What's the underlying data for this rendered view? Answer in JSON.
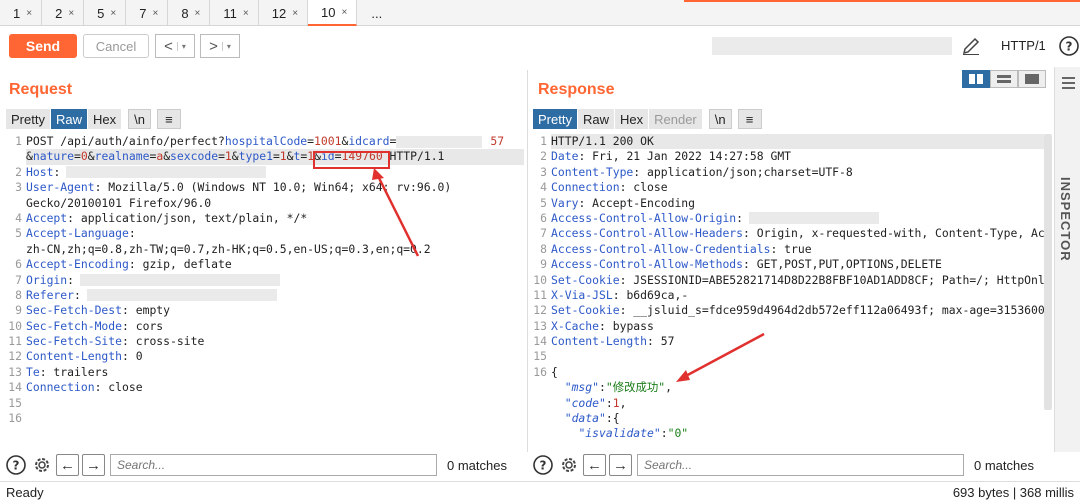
{
  "tabs": [
    {
      "label": "1",
      "close": "×"
    },
    {
      "label": "2",
      "close": "×"
    },
    {
      "label": "5",
      "close": "×"
    },
    {
      "label": "7",
      "close": "×"
    },
    {
      "label": "8",
      "close": "×"
    },
    {
      "label": "11",
      "close": "×"
    },
    {
      "label": "12",
      "close": "×"
    },
    {
      "label": "10",
      "close": "×"
    },
    {
      "label": "...",
      "close": ""
    }
  ],
  "toolbar": {
    "send_label": "Send",
    "cancel_label": "Cancel",
    "back_label": "<",
    "forward_label": ">",
    "caret": "▾",
    "http_version": "HTTP/1"
  },
  "request": {
    "title": "Request",
    "subtabs": {
      "pretty": "Pretty",
      "raw": "Raw",
      "hex": "Hex",
      "newline": "\\n",
      "menu": "≡"
    },
    "lines": [
      {
        "num": "1",
        "parts": [
          "POST /api/auth/ainfo/perfect?",
          "hospitalCode",
          "=",
          "1001",
          "&",
          "idcard",
          "=",
          "57"
        ]
      },
      {
        "num": "",
        "parts": [
          "&",
          "nature",
          "=",
          "0",
          "&",
          "realname",
          "=",
          "a",
          "&",
          "sexcode",
          "=",
          "1",
          "&",
          "type1",
          "=",
          "1",
          "&",
          "t",
          "=",
          "1",
          "&",
          "id",
          "=",
          "149760",
          " HTTP/1.1"
        ]
      },
      {
        "num": "2",
        "key": "Host",
        "value": ""
      },
      {
        "num": "3",
        "key": "User-Agent",
        "value": " Mozilla/5.0 (Windows NT 10.0; Win64; x64; rv:96.0)"
      },
      {
        "num": "",
        "key": "",
        "value": "Gecko/20100101 Firefox/96.0"
      },
      {
        "num": "4",
        "key": "Accept",
        "value": " application/json, text/plain, */*"
      },
      {
        "num": "5",
        "key": "Accept-Language",
        "value": ""
      },
      {
        "num": "",
        "key": "",
        "value": "zh-CN,zh;q=0.8,zh-TW;q=0.7,zh-HK;q=0.5,en-US;q=0.3,en;q=0.2"
      },
      {
        "num": "6",
        "key": "Accept-Encoding",
        "value": " gzip, deflate"
      },
      {
        "num": "7",
        "key": "Origin",
        "value": ""
      },
      {
        "num": "8",
        "key": "Referer",
        "value": ""
      },
      {
        "num": "9",
        "key": "Sec-Fetch-Dest",
        "value": " empty"
      },
      {
        "num": "10",
        "key": "Sec-Fetch-Mode",
        "value": " cors"
      },
      {
        "num": "11",
        "key": "Sec-Fetch-Site",
        "value": " cross-site"
      },
      {
        "num": "12",
        "key": "Content-Length",
        "value": " 0"
      },
      {
        "num": "13",
        "key": "Te",
        "value": " trailers"
      },
      {
        "num": "14",
        "key": "Connection",
        "value": " close"
      },
      {
        "num": "15",
        "key": "",
        "value": ""
      },
      {
        "num": "16",
        "key": "",
        "value": ""
      }
    ],
    "search_placeholder": "Search...",
    "matches": "0 matches"
  },
  "response": {
    "title": "Response",
    "subtabs": {
      "pretty": "Pretty",
      "raw": "Raw",
      "hex": "Hex",
      "render": "Render",
      "newline": "\\n",
      "menu": "≡"
    },
    "status_line": "HTTP/1.1 200 OK",
    "headers": [
      {
        "num": "2",
        "key": "Date",
        "value": " Fri, 21 Jan 2022 14:27:58 GMT"
      },
      {
        "num": "3",
        "key": "Content-Type",
        "value": " application/json;charset=UTF-8"
      },
      {
        "num": "4",
        "key": "Connection",
        "value": " close"
      },
      {
        "num": "5",
        "key": "Vary",
        "value": " Accept-Encoding"
      },
      {
        "num": "6",
        "key": "Access-Control-Allow-Origin",
        "value": ""
      },
      {
        "num": "7",
        "key": "Access-Control-Allow-Headers",
        "value": " Origin, x-requested-with, Content-Type, Ac"
      },
      {
        "num": "8",
        "key": "Access-Control-Allow-Credentials",
        "value": " true"
      },
      {
        "num": "9",
        "key": "Access-Control-Allow-Methods",
        "value": " GET,POST,PUT,OPTIONS,DELETE"
      },
      {
        "num": "10",
        "key": "Set-Cookie",
        "value": " JSESSIONID=ABE52821714D8D22B8FBF10AD1ADD8CF; Path=/; HttpOnl"
      },
      {
        "num": "11",
        "key": "X-Via-JSL",
        "value": " b6d69ca,-"
      },
      {
        "num": "12",
        "key": "Set-Cookie",
        "value": " __jsluid_s=fdce959d4964d2db572eff112a06493f; max-age=3153600"
      },
      {
        "num": "13",
        "key": "X-Cache",
        "value": " bypass"
      },
      {
        "num": "14",
        "key": "Content-Length",
        "value": " 57"
      }
    ],
    "json": {
      "open": "{",
      "msg_key": "\"msg\"",
      "msg_val": "\"修改成功\"",
      "code_key": "\"code\"",
      "code_val": "1",
      "data_key": "\"data\"",
      "isvalidate_key": "\"isvalidate\"",
      "isvalidate_val": "\"0\""
    },
    "search_placeholder": "Search...",
    "matches": "0 matches"
  },
  "inspector_label": "INSPECTOR",
  "status": {
    "left": "Ready",
    "right": "693 bytes | 368 millis"
  },
  "colors": {
    "accent": "#ff6633",
    "selected": "#2e6ca4",
    "annotation": "#e0312f"
  }
}
